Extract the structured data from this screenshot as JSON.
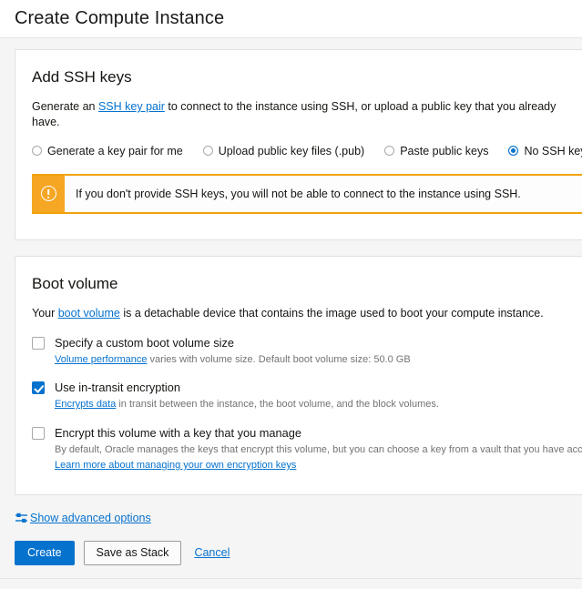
{
  "window": {
    "title": "Create Compute Instance"
  },
  "ssh_section": {
    "heading": "Add SSH keys",
    "description_before": "Generate an ",
    "description_link": "SSH key pair",
    "description_after": " to connect to the instance using SSH, or upload a public key that you already have.",
    "options": [
      {
        "label": "Generate a key pair for me",
        "selected": false
      },
      {
        "label": "Upload public key files (.pub)",
        "selected": false
      },
      {
        "label": "Paste public keys",
        "selected": false
      },
      {
        "label": "No SSH keys",
        "selected": true
      }
    ],
    "warning": {
      "icon": "exclamation-circle-icon",
      "text": "If you don't provide SSH keys, you will not be able to connect to the instance using SSH.",
      "accent_color": "#f5a623",
      "border_color": "#f0a30a"
    }
  },
  "boot_section": {
    "heading": "Boot volume",
    "description_before": "Your ",
    "description_link": "boot volume",
    "description_after": " is a detachable device that contains the image used to boot your compute instance.",
    "checkboxes": [
      {
        "label": "Specify a custom boot volume size",
        "checked": false,
        "sub_link": "Volume performance",
        "sub_text": " varies with volume size. Default boot volume size: 50.0 GB",
        "sub_link2": "",
        "sub_text2": ""
      },
      {
        "label": "Use in-transit encryption",
        "checked": true,
        "sub_link": "Encrypts data",
        "sub_text": " in transit between the instance, the boot volume, and the block volumes.",
        "sub_link2": "",
        "sub_text2": ""
      },
      {
        "label": "Encrypt this volume with a key that you manage",
        "checked": false,
        "sub_link": "",
        "sub_text": "By default, Oracle manages the keys that encrypt this volume, but you can choose a key from a vault that you have access to if you want greater",
        "sub_link2": "Learn more about managing your own encryption keys",
        "sub_text2": ""
      }
    ]
  },
  "advanced": {
    "icon": "sliders-icon",
    "label": "Show advanced options"
  },
  "footer": {
    "create_label": "Create",
    "save_stack_label": "Save as Stack",
    "cancel_label": "Cancel",
    "primary_color": "#0572ce"
  }
}
